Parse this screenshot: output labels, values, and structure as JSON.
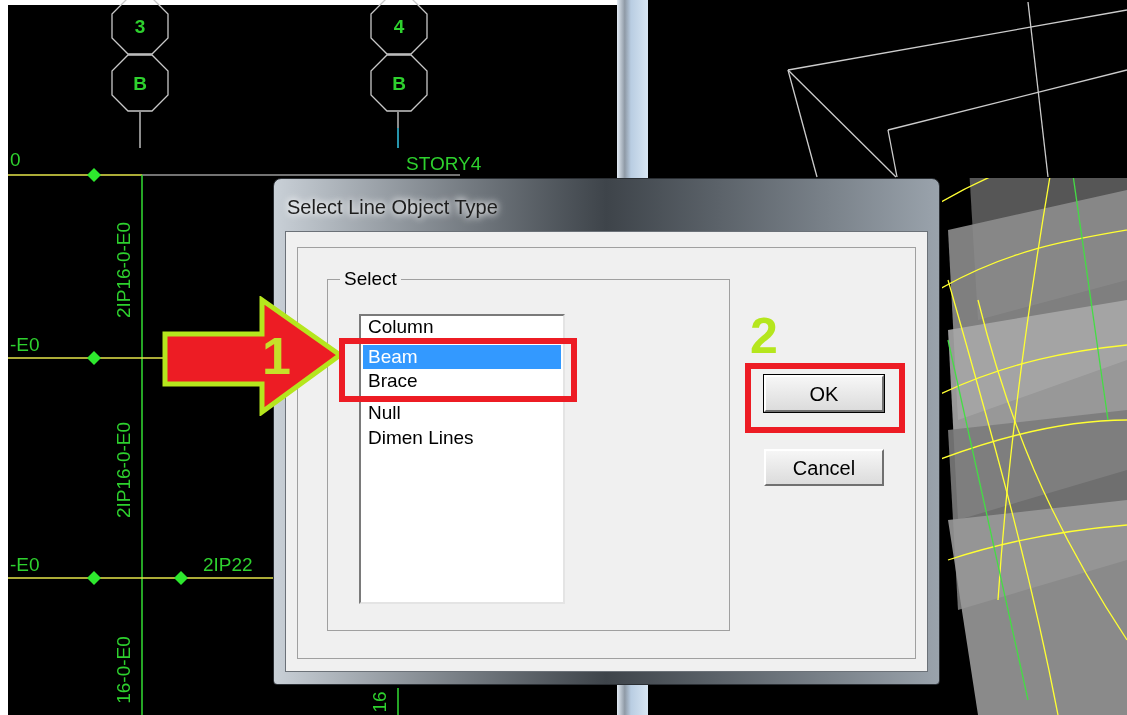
{
  "cad_view": {
    "bubbles": [
      {
        "label": "3"
      },
      {
        "label": "B"
      },
      {
        "label": "4"
      },
      {
        "label": "B"
      }
    ],
    "labels": [
      {
        "text": "0"
      },
      {
        "text": "STORY4"
      },
      {
        "text": "2IP16-0-E0"
      },
      {
        "text": "-E0"
      },
      {
        "text": "2IP16-0-E0"
      },
      {
        "text": "-E0"
      },
      {
        "text": "2IP22"
      },
      {
        "text": "16-0-E0"
      },
      {
        "text": "16"
      }
    ]
  },
  "dialog": {
    "title": "Select Line Object Type",
    "group_label": "Select",
    "items": [
      {
        "label": "Column",
        "selected": false
      },
      {
        "label": "Beam",
        "selected": true
      },
      {
        "label": "Brace",
        "selected": false
      },
      {
        "label": "Null",
        "selected": false
      },
      {
        "label": "Dimen Lines",
        "selected": false
      }
    ],
    "buttons": [
      {
        "label": "OK"
      },
      {
        "label": "Cancel"
      }
    ]
  },
  "annotations": [
    {
      "label": "1"
    },
    {
      "label": "2"
    }
  ]
}
